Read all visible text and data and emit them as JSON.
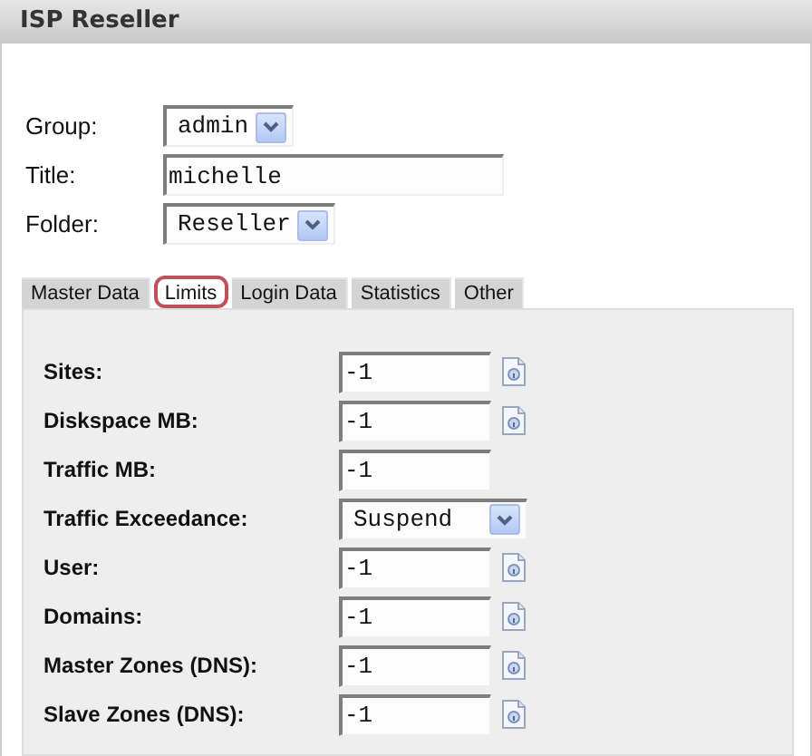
{
  "header": {
    "title": "ISP Reseller"
  },
  "general_fields": [
    {
      "label": "Group:",
      "kind": "select",
      "value": "admin"
    },
    {
      "label": "Title:",
      "kind": "text",
      "value": "michelle"
    },
    {
      "label": "Folder:",
      "kind": "select",
      "value": "Reseller"
    }
  ],
  "tabs": [
    {
      "label": "Master Data",
      "selected": false
    },
    {
      "label": "Limits",
      "selected": true
    },
    {
      "label": "Login Data",
      "selected": false
    },
    {
      "label": "Statistics",
      "selected": false
    },
    {
      "label": "Other",
      "selected": false
    }
  ],
  "limits": [
    {
      "label": "Sites:",
      "kind": "text",
      "value": "-1",
      "help": true
    },
    {
      "label": "Diskspace MB:",
      "kind": "text",
      "value": "-1",
      "help": true
    },
    {
      "label": "Traffic MB:",
      "kind": "text",
      "value": "-1",
      "help": false
    },
    {
      "label": "Traffic Exceedance:",
      "kind": "select",
      "value": "Suspend",
      "help": false
    },
    {
      "label": "User:",
      "kind": "text",
      "value": "-1",
      "help": true
    },
    {
      "label": "Domains:",
      "kind": "text",
      "value": "-1",
      "help": true
    },
    {
      "label": "Master Zones (DNS):",
      "kind": "text",
      "value": "-1",
      "help": true
    },
    {
      "label": "Slave Zones (DNS):",
      "kind": "text",
      "value": "-1",
      "help": true
    }
  ]
}
